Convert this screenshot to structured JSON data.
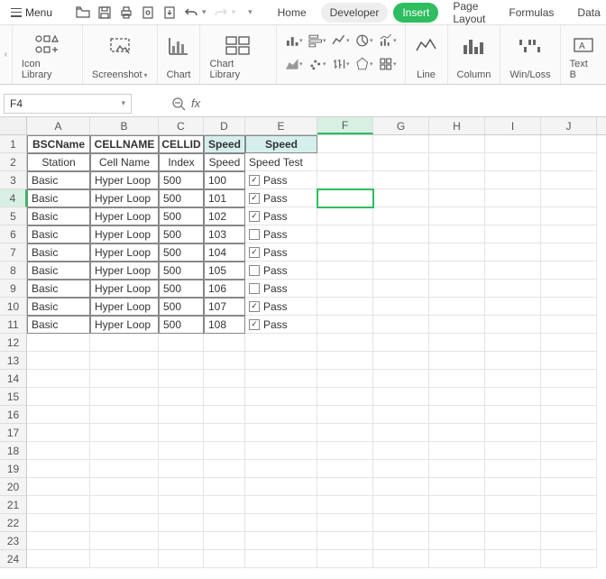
{
  "menubar": {
    "menu_label": "Menu",
    "tabs": [
      "Home",
      "Developer",
      "Insert",
      "Page Layout",
      "Formulas",
      "Data"
    ]
  },
  "ribbon": {
    "groups": {
      "icon_library": "Icon Library",
      "screenshot": "Screenshot",
      "chart": "Chart",
      "chart_library": "Chart Library",
      "line": "Line",
      "column": "Column",
      "winloss": "Win/Loss",
      "textbox": "Text B"
    }
  },
  "namebox": {
    "value": "F4"
  },
  "formula": {
    "value": ""
  },
  "columns": [
    "A",
    "B",
    "C",
    "D",
    "E",
    "F",
    "G",
    "H",
    "I",
    "J"
  ],
  "active_col": "F",
  "active_row": 4,
  "header_row1": {
    "A": "BSCName",
    "B": "CELLNAME",
    "C": "CELLID",
    "D": "Speed",
    "E": "Speed"
  },
  "header_row2": {
    "A": "Station",
    "B": "Cell Name",
    "C": "Index",
    "D": "Speed",
    "E": "Speed Test"
  },
  "data_rows": [
    {
      "A": "Basic",
      "B": "Hyper Loop",
      "C": "500",
      "D": "100",
      "E_checked": true,
      "E_label": "Pass"
    },
    {
      "A": "Basic",
      "B": "Hyper Loop",
      "C": "500",
      "D": "101",
      "E_checked": true,
      "E_label": "Pass"
    },
    {
      "A": "Basic",
      "B": "Hyper Loop",
      "C": "500",
      "D": "102",
      "E_checked": true,
      "E_label": "Pass"
    },
    {
      "A": "Basic",
      "B": "Hyper Loop",
      "C": "500",
      "D": "103",
      "E_checked": false,
      "E_label": "Pass"
    },
    {
      "A": "Basic",
      "B": "Hyper Loop",
      "C": "500",
      "D": "104",
      "E_checked": true,
      "E_label": "Pass"
    },
    {
      "A": "Basic",
      "B": "Hyper Loop",
      "C": "500",
      "D": "105",
      "E_checked": false,
      "E_label": "Pass"
    },
    {
      "A": "Basic",
      "B": "Hyper Loop",
      "C": "500",
      "D": "106",
      "E_checked": false,
      "E_label": "Pass"
    },
    {
      "A": "Basic",
      "B": "Hyper Loop",
      "C": "500",
      "D": "107",
      "E_checked": true,
      "E_label": "Pass"
    },
    {
      "A": "Basic",
      "B": "Hyper Loop",
      "C": "500",
      "D": "108",
      "E_checked": true,
      "E_label": "Pass"
    }
  ],
  "total_rows": 24
}
